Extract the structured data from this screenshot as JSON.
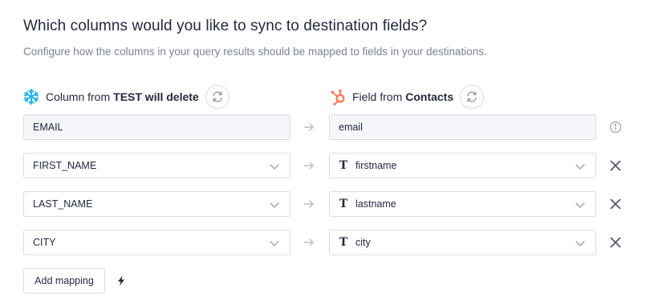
{
  "header": {
    "title": "Which columns would you like to sync to destination fields?",
    "subtitle": "Configure how the columns in your query results should be mapped to fields in your destinations."
  },
  "source_column": {
    "label_prefix": "Column from",
    "label_name": "TEST will delete",
    "icon": "snowflake-icon",
    "icon_color": "#29b5e8"
  },
  "destination_column": {
    "label_prefix": "Field from",
    "label_name": "Contacts",
    "icon": "hubspot-icon",
    "icon_color": "#ff7a59"
  },
  "mappings": [
    {
      "source": "EMAIL",
      "destination": "email",
      "locked": true,
      "type_icon": "",
      "trailing_icon": "info-icon"
    },
    {
      "source": "FIRST_NAME",
      "destination": "firstname",
      "locked": false,
      "type_icon": "T",
      "trailing_icon": "remove-icon"
    },
    {
      "source": "LAST_NAME",
      "destination": "lastname",
      "locked": false,
      "type_icon": "T",
      "trailing_icon": "remove-icon"
    },
    {
      "source": "CITY",
      "destination": "city",
      "locked": false,
      "type_icon": "T",
      "trailing_icon": "remove-icon"
    }
  ],
  "actions": {
    "add_mapping_label": "Add mapping"
  }
}
